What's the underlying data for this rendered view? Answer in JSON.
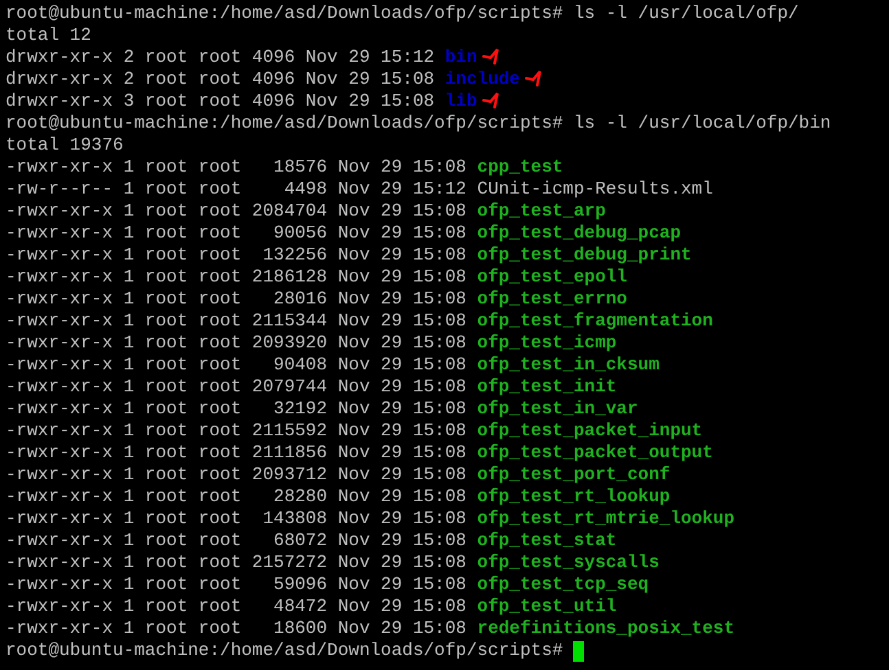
{
  "terminal": {
    "lines": [
      {
        "kind": "prompt",
        "prompt": "root@ubuntu-machine:/home/asd/Downloads/ofp/scripts#",
        "command": "ls -l /usr/local/ofp/"
      },
      {
        "kind": "text",
        "text": "total 12"
      },
      {
        "kind": "entry",
        "info": "drwxr-xr-x 2 root root 4096 Nov 29 15:12",
        "name": "bin",
        "color": "#0000c8",
        "marked": true
      },
      {
        "kind": "entry",
        "info": "drwxr-xr-x 2 root root 4096 Nov 29 15:08",
        "name": "include",
        "color": "#0000c8",
        "marked": true
      },
      {
        "kind": "entry",
        "info": "drwxr-xr-x 3 root root 4096 Nov 29 15:08",
        "name": "lib",
        "color": "#0000c8",
        "marked": true
      },
      {
        "kind": "prompt",
        "prompt": "root@ubuntu-machine:/home/asd/Downloads/ofp/scripts#",
        "command": "ls -l /usr/local/ofp/bin"
      },
      {
        "kind": "text",
        "text": "total 19376"
      },
      {
        "kind": "entry",
        "info": "-rwxr-xr-x 1 root root   18576 Nov 29 15:08",
        "name": "cpp_test",
        "color": "#1fb21f",
        "marked": false
      },
      {
        "kind": "entry",
        "info": "-rw-r--r-- 1 root root    4498 Nov 29 15:12",
        "name": "CUnit-icmp-Results.xml",
        "color": "#c0c0c0",
        "marked": false
      },
      {
        "kind": "entry",
        "info": "-rwxr-xr-x 1 root root 2084704 Nov 29 15:08",
        "name": "ofp_test_arp",
        "color": "#1fb21f",
        "marked": false
      },
      {
        "kind": "entry",
        "info": "-rwxr-xr-x 1 root root   90056 Nov 29 15:08",
        "name": "ofp_test_debug_pcap",
        "color": "#1fb21f",
        "marked": false
      },
      {
        "kind": "entry",
        "info": "-rwxr-xr-x 1 root root  132256 Nov 29 15:08",
        "name": "ofp_test_debug_print",
        "color": "#1fb21f",
        "marked": false
      },
      {
        "kind": "entry",
        "info": "-rwxr-xr-x 1 root root 2186128 Nov 29 15:08",
        "name": "ofp_test_epoll",
        "color": "#1fb21f",
        "marked": false
      },
      {
        "kind": "entry",
        "info": "-rwxr-xr-x 1 root root   28016 Nov 29 15:08",
        "name": "ofp_test_errno",
        "color": "#1fb21f",
        "marked": false
      },
      {
        "kind": "entry",
        "info": "-rwxr-xr-x 1 root root 2115344 Nov 29 15:08",
        "name": "ofp_test_fragmentation",
        "color": "#1fb21f",
        "marked": false
      },
      {
        "kind": "entry",
        "info": "-rwxr-xr-x 1 root root 2093920 Nov 29 15:08",
        "name": "ofp_test_icmp",
        "color": "#1fb21f",
        "marked": false
      },
      {
        "kind": "entry",
        "info": "-rwxr-xr-x 1 root root   90408 Nov 29 15:08",
        "name": "ofp_test_in_cksum",
        "color": "#1fb21f",
        "marked": false
      },
      {
        "kind": "entry",
        "info": "-rwxr-xr-x 1 root root 2079744 Nov 29 15:08",
        "name": "ofp_test_init",
        "color": "#1fb21f",
        "marked": false
      },
      {
        "kind": "entry",
        "info": "-rwxr-xr-x 1 root root   32192 Nov 29 15:08",
        "name": "ofp_test_in_var",
        "color": "#1fb21f",
        "marked": false
      },
      {
        "kind": "entry",
        "info": "-rwxr-xr-x 1 root root 2115592 Nov 29 15:08",
        "name": "ofp_test_packet_input",
        "color": "#1fb21f",
        "marked": false
      },
      {
        "kind": "entry",
        "info": "-rwxr-xr-x 1 root root 2111856 Nov 29 15:08",
        "name": "ofp_test_packet_output",
        "color": "#1fb21f",
        "marked": false
      },
      {
        "kind": "entry",
        "info": "-rwxr-xr-x 1 root root 2093712 Nov 29 15:08",
        "name": "ofp_test_port_conf",
        "color": "#1fb21f",
        "marked": false
      },
      {
        "kind": "entry",
        "info": "-rwxr-xr-x 1 root root   28280 Nov 29 15:08",
        "name": "ofp_test_rt_lookup",
        "color": "#1fb21f",
        "marked": false
      },
      {
        "kind": "entry",
        "info": "-rwxr-xr-x 1 root root  143808 Nov 29 15:08",
        "name": "ofp_test_rt_mtrie_lookup",
        "color": "#1fb21f",
        "marked": false
      },
      {
        "kind": "entry",
        "info": "-rwxr-xr-x 1 root root   68072 Nov 29 15:08",
        "name": "ofp_test_stat",
        "color": "#1fb21f",
        "marked": false
      },
      {
        "kind": "entry",
        "info": "-rwxr-xr-x 1 root root 2157272 Nov 29 15:08",
        "name": "ofp_test_syscalls",
        "color": "#1fb21f",
        "marked": false
      },
      {
        "kind": "entry",
        "info": "-rwxr-xr-x 1 root root   59096 Nov 29 15:08",
        "name": "ofp_test_tcp_seq",
        "color": "#1fb21f",
        "marked": false
      },
      {
        "kind": "entry",
        "info": "-rwxr-xr-x 1 root root   48472 Nov 29 15:08",
        "name": "ofp_test_util",
        "color": "#1fb21f",
        "marked": false
      },
      {
        "kind": "entry",
        "info": "-rwxr-xr-x 1 root root   18600 Nov 29 15:08",
        "name": "redefinitions_posix_test",
        "color": "#1fb21f",
        "marked": false
      },
      {
        "kind": "prompt",
        "prompt": "root@ubuntu-machine:/home/asd/Downloads/ofp/scripts#",
        "cursor": true
      }
    ]
  }
}
